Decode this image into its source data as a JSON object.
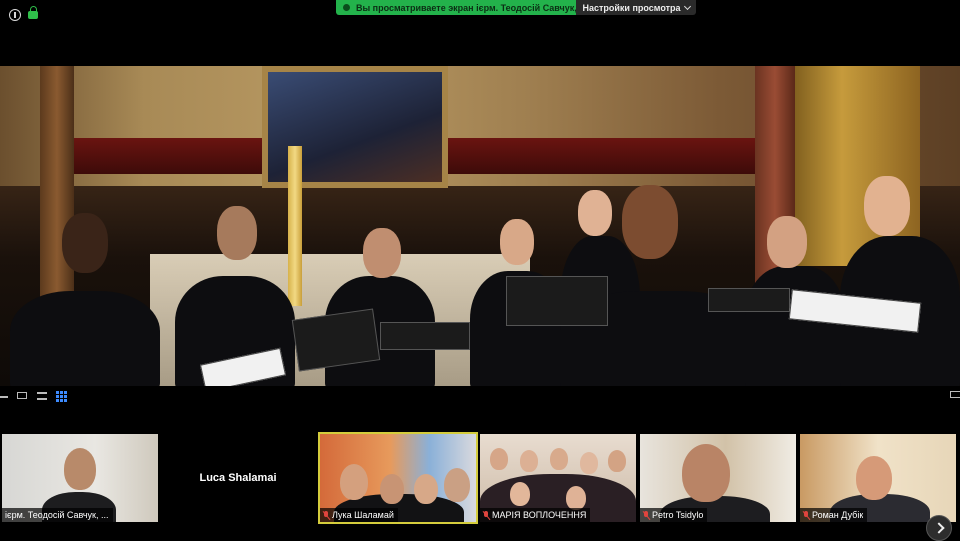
{
  "top_bar": {
    "share_banner_text": "Вы просматриваете экран ієрм. Теодосій Савчук, ВС",
    "view_options_label": "Настройки просмотра"
  },
  "gallery": {
    "participants": [
      {
        "name": "ієрм. Теодосій Савчук, ...",
        "muted": false,
        "has_video": true
      },
      {
        "name": "Luca Shalamai",
        "muted": false,
        "has_video": false
      },
      {
        "name": "Лука Шаламай",
        "muted": true,
        "has_video": true,
        "active_speaker": true
      },
      {
        "name": "МАРІЯ ВОПЛОЧЕННЯ",
        "muted": true,
        "has_video": true
      },
      {
        "name": "Petro Tsidylo",
        "muted": true,
        "has_video": true
      },
      {
        "name": "Роман Дубік",
        "muted": true,
        "has_video": true
      }
    ]
  },
  "colors": {
    "share_banner": "#23b24b",
    "active_speaker_border": "#d4cc3c",
    "muted_mic": "#e0443e",
    "grid_view_accent": "#3d8bff"
  },
  "icons": [
    "info-icon",
    "lock-icon",
    "chevron-down-icon",
    "minimize-icon",
    "speaker-view-icon",
    "strip-view-icon",
    "grid-view-icon",
    "exit-fullscreen-icon",
    "mic-muted-icon",
    "chevron-right-icon"
  ]
}
